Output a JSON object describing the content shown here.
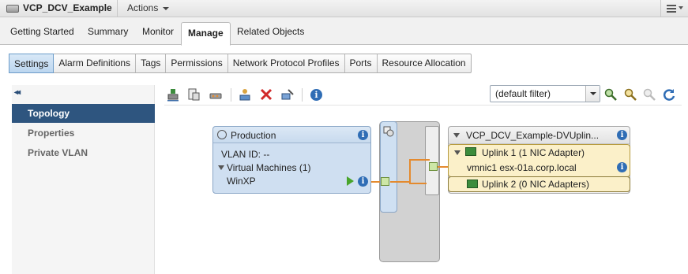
{
  "window": {
    "title": "VCP_DCV_Example",
    "actions_label": "Actions"
  },
  "main_tabs": [
    {
      "label": "Getting Started"
    },
    {
      "label": "Summary"
    },
    {
      "label": "Monitor"
    },
    {
      "label": "Manage",
      "active": true
    },
    {
      "label": "Related Objects"
    }
  ],
  "sub_tabs": [
    {
      "label": "Settings",
      "active": true
    },
    {
      "label": "Alarm Definitions"
    },
    {
      "label": "Tags"
    },
    {
      "label": "Permissions"
    },
    {
      "label": "Network Protocol Profiles"
    },
    {
      "label": "Ports"
    },
    {
      "label": "Resource Allocation"
    }
  ],
  "sidebar": {
    "collapse_glyph": "◂◂",
    "items": [
      {
        "label": "Topology",
        "active": true
      },
      {
        "label": "Properties"
      },
      {
        "label": "Private VLAN"
      }
    ]
  },
  "toolbar": {
    "icons": [
      "add-host-icon",
      "manage-host-networking-icon",
      "migrate-vm-icon",
      "add-user-icon",
      "remove-icon",
      "edit-settings-icon",
      "info-icon"
    ],
    "filter_value": "(default filter)",
    "right_icons": [
      "search-icon",
      "filter-icon",
      "clear-filter-icon",
      "refresh-icon"
    ]
  },
  "topology": {
    "port_group": {
      "name": "Production",
      "vlan": "VLAN ID: --",
      "vms_header": "Virtual Machines (1)",
      "vm": "WinXP"
    },
    "uplinks_group": {
      "name": "VCP_DCV_Example-DVUplin...",
      "uplink1_label": "Uplink 1 (1 NIC Adapter)",
      "uplink1_nic": "vmnic1 esx-01a.corp.local",
      "uplink2_label": "Uplink 2 (0 NIC Adapters)"
    }
  },
  "colors": {
    "accent": "#2e557f",
    "info": "#2f6db5",
    "connection": "#e48a2e",
    "uplink_fill": "#fbf0c9"
  }
}
